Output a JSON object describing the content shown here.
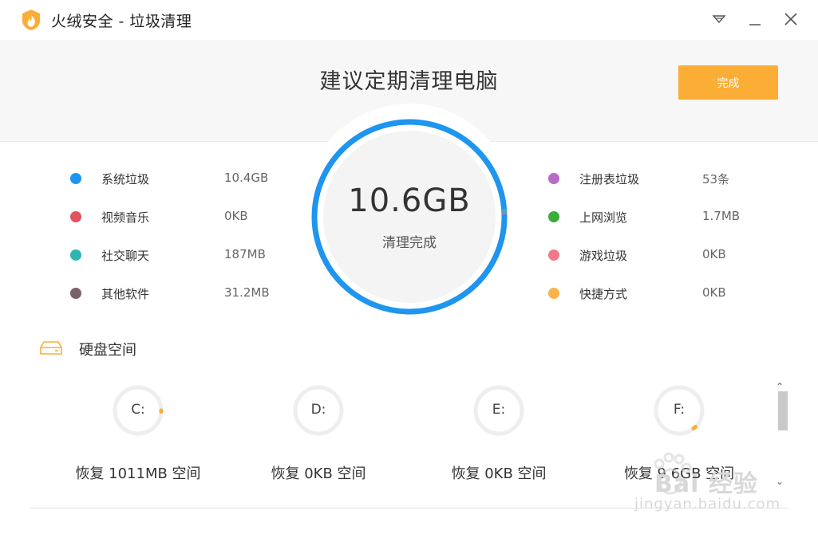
{
  "window": {
    "title": "火绒安全 - 垃圾清理",
    "colors": {
      "accent": "#fbad35",
      "ring": "#1e95ee"
    }
  },
  "header": {
    "headline": "建议定期清理电脑",
    "done_label": "完成"
  },
  "summary": {
    "total": "10.6GB",
    "caption": "清理完成"
  },
  "categories_left": [
    {
      "label": "系统垃圾",
      "value": "10.4GB",
      "color": "#1e95ee"
    },
    {
      "label": "视频音乐",
      "value": "0KB",
      "color": "#e05460"
    },
    {
      "label": "社交聊天",
      "value": "187MB",
      "color": "#2eb5b1"
    },
    {
      "label": "其他软件",
      "value": "31.2MB",
      "color": "#7a6268"
    }
  ],
  "categories_right": [
    {
      "label": "注册表垃圾",
      "value": "53条",
      "color": "#b76bc9"
    },
    {
      "label": "上网浏览",
      "value": "1.7MB",
      "color": "#3aac3a"
    },
    {
      "label": "游戏垃圾",
      "value": "0KB",
      "color": "#f07a8a"
    },
    {
      "label": "快捷方式",
      "value": "0KB",
      "color": "#fbb24a"
    }
  ],
  "disk": {
    "title": "硬盘空间",
    "drives": [
      {
        "letter": "C:",
        "recover": "恢复 1011MB 空间"
      },
      {
        "letter": "D:",
        "recover": "恢复 0KB 空间"
      },
      {
        "letter": "E:",
        "recover": "恢复 0KB 空间"
      },
      {
        "letter": "F:",
        "recover": "恢复 9.6GB 空间"
      }
    ]
  },
  "watermark": {
    "text": "Bai 经验",
    "sub": "jingyan.baidu.com"
  }
}
